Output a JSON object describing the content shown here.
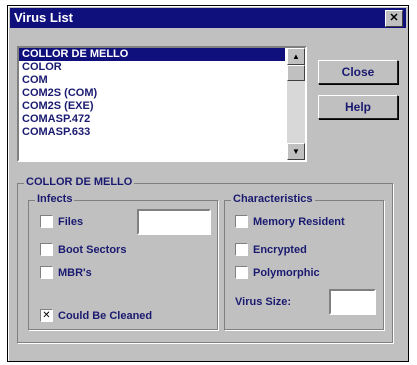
{
  "window": {
    "title": "Virus List",
    "close_glyph": "✕"
  },
  "virus_list": {
    "items": [
      "COLLOR DE MELLO",
      "COLOR",
      "COM",
      "COM2S (COM)",
      "COM2S (EXE)",
      "COMASP.472",
      "COMASP.633"
    ],
    "selected_index": 0,
    "scroll_up_glyph": "▲",
    "scroll_down_glyph": "▼"
  },
  "buttons": {
    "close": "Close",
    "help": "Help"
  },
  "details": {
    "group_label": "COLLOR DE MELLO",
    "infects": {
      "label": "Infects",
      "files": {
        "label": "Files",
        "checked": false
      },
      "boot_sectors": {
        "label": "Boot Sectors",
        "checked": false
      },
      "mbrs": {
        "label": "MBR's",
        "checked": false
      },
      "files_count_value": ""
    },
    "characteristics": {
      "label": "Characteristics",
      "memory_resident": {
        "label": "Memory Resident",
        "checked": false
      },
      "encrypted": {
        "label": "Encrypted",
        "checked": false
      },
      "polymorphic": {
        "label": "Polymorphic",
        "checked": false
      },
      "virus_size_label": "Virus Size:",
      "virus_size_value": ""
    },
    "could_be_cleaned": {
      "label": "Could Be Cleaned",
      "checked": true,
      "mark": "✕"
    }
  }
}
